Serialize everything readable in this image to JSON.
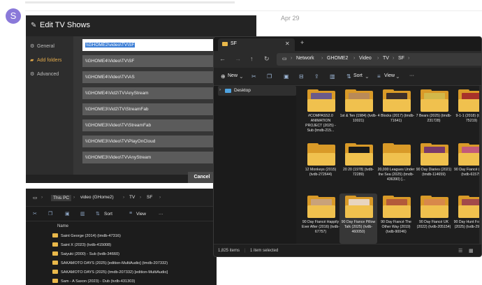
{
  "forum": {
    "avatar_letter": "S",
    "post_date": "Apr 29"
  },
  "dialog": {
    "title": "Edit TV Shows",
    "sidebar": [
      {
        "label": "General",
        "icon": "gear-icon"
      },
      {
        "label": "Add folders",
        "icon": "folder-icon",
        "active": true
      },
      {
        "label": "Advanced",
        "icon": "gear-icon"
      }
    ],
    "paths": [
      "\\\\GHOME2\\video\\TV\\SF",
      "\\\\GHOME4\\Video\\TV\\SF",
      "\\\\GHOME4\\Video\\TV\\AS",
      "\\\\GHOME4\\Vid2\\TV\\AnyStream",
      "\\\\GHOME3\\Vid2\\TV\\StreamFab",
      "\\\\GHOME3\\Video\\TV\\StreamFab",
      "\\\\GHOME3\\Video\\TV\\PlayOnCloud",
      "\\\\GHOME3\\Video\\TV\\AnyStream"
    ],
    "cancel_label": "Cancel"
  },
  "explorer2": {
    "breadcrumb": [
      "This PC",
      "video (GHome2)",
      "TV",
      "SF"
    ],
    "sort_label": "Sort",
    "view_label": "View",
    "more_label": "···",
    "column_name": "Name",
    "rows": [
      "Saint George (2014) (tmdb-47316)",
      "Saint X (2023) (tvdb-415008)",
      "Saiyuki (2000) - Sub (tvdb-34660)",
      "SAKAMOTO DAYS (2025) [edition-MultiAudio] (tmdb-207332)",
      "SAKAMOTO DAYS (2025) (tmdb-207332) [edition-MultiAudio]",
      "Sam - A Saxon (2023) - Dub (tvdb-431303)"
    ]
  },
  "explorer": {
    "tab_title": "SF",
    "tab_close": "✕",
    "tab_add": "+",
    "breadcrumb": [
      "Network",
      "GHOME2",
      "Video",
      "TV",
      "SF"
    ],
    "new_label": "New",
    "sort_label": "Sort",
    "view_label": "View",
    "more_label": "···",
    "nav_pane": {
      "label": "Desktop"
    },
    "items": [
      {
        "name": "#COMPASS2.0 ANIMATION PROJECT (2025) - Sub (tmdb-215...",
        "poster": "#6b5a8a"
      },
      {
        "name": "1st & Ten (1984) (tvdb-10021)",
        "poster": "#b98a58"
      },
      {
        "name": "4 Blocks (2017) (tmdb-71641)",
        "poster": "#3d2f2a"
      },
      {
        "name": "7 Bears (2025) (tmdb-231728)",
        "poster": "#d2b84a"
      },
      {
        "name": "9-1-1 (2018) (tmdb-75219)",
        "poster": "#a8322a"
      },
      {
        "name": "12 Monkeys (2015) (tvdb-272644)",
        "poster": ""
      },
      {
        "name": "20 20 (1978) (tvdb-72289)",
        "poster": "#1a1a1a"
      },
      {
        "name": "20,000 Leagues Under the Sea (2025) (tmdb-436390) [...",
        "poster": ""
      },
      {
        "name": "90 Day Diaries (2021) (tmdb-114659)",
        "poster": "#7a3a6a"
      },
      {
        "name": "90 Day Fiancé (2014) (tvdb-61575)",
        "poster": "#c25a7a"
      },
      {
        "name": "90 Day Fiancé Happily Ever After (2016) (tvdb-67757)",
        "poster": "#c9a27a"
      },
      {
        "name": "90 Day Fiance Pillow Talk (2025) (tvdb-460050)",
        "poster": "#e8d5c0"
      },
      {
        "name": "90 Day Fiancé The Other Way (2019) (tvdb-90046)",
        "poster": "#b35a3a"
      },
      {
        "name": "90 Day Fiancé UK (2022) (tvdb-205154)",
        "poster": "#d8884a"
      },
      {
        "name": "90 Day Hunt For Love (2025) (tvdb-290564)",
        "poster": "#a24a4a"
      }
    ],
    "status_count": "1,825 items",
    "status_selected": "1 item selected"
  }
}
